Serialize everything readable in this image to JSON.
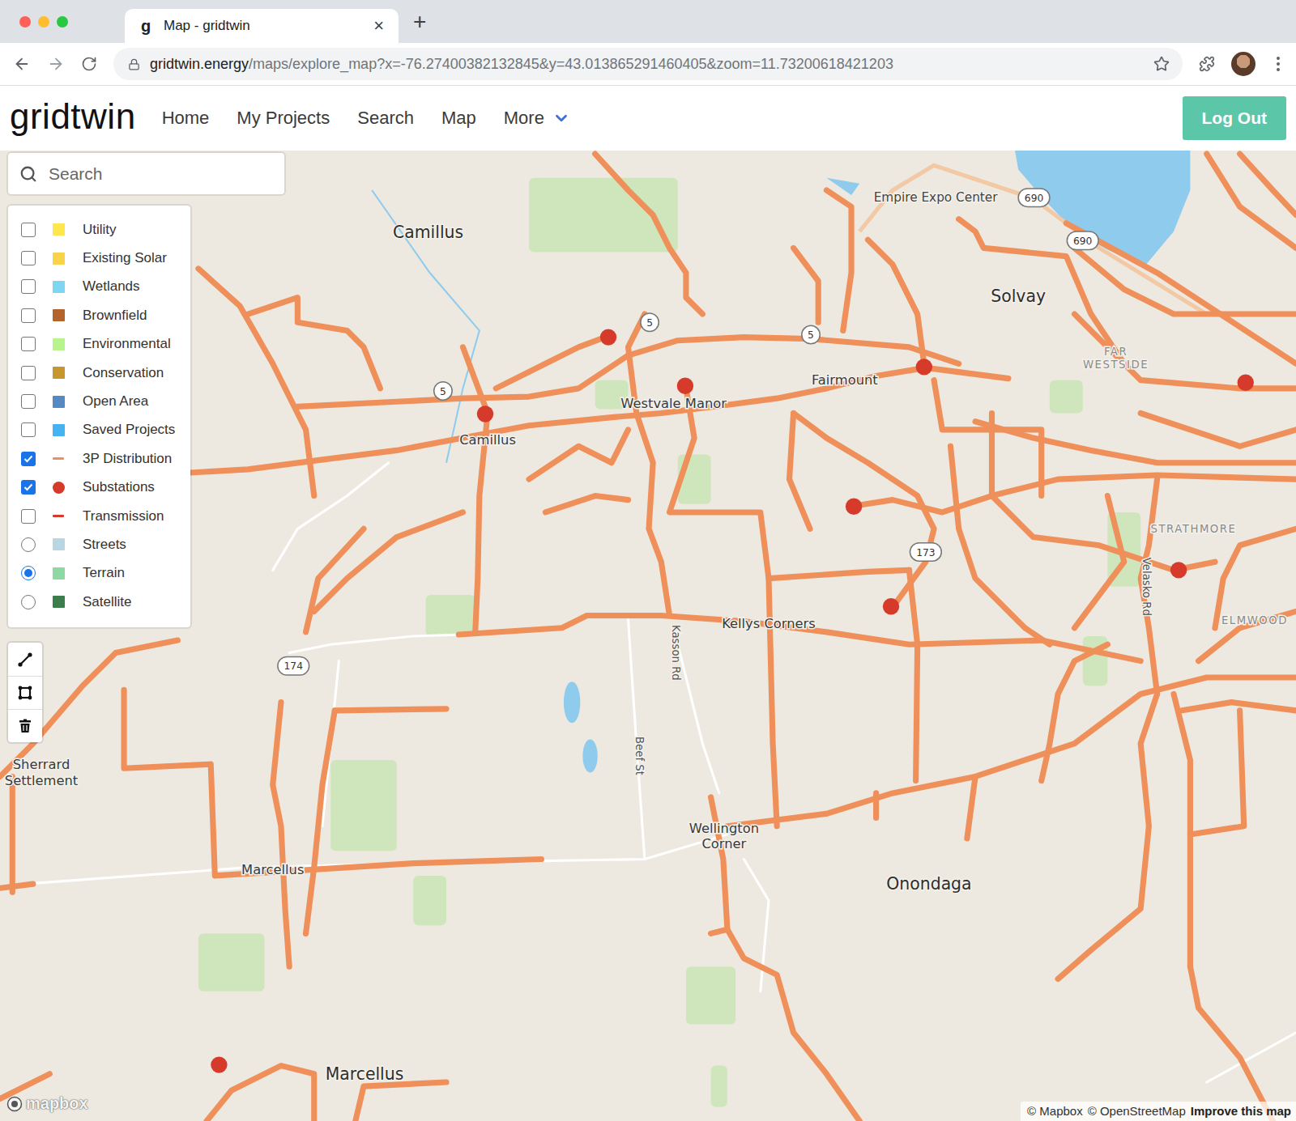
{
  "browser": {
    "tab": {
      "favicon": "g",
      "title": "Map - gridtwin",
      "close": "×"
    },
    "new_tab": "+",
    "address": {
      "host": "gridtwin.energy",
      "path": "/maps/explore_map?x=-76.27400382132845&y=43.013865291460405&zoom=11.73200618421203"
    }
  },
  "app": {
    "logo": "gridtwin",
    "nav": [
      {
        "label": "Home",
        "selected": false
      },
      {
        "label": "My Projects",
        "selected": false
      },
      {
        "label": "Search",
        "selected": false
      },
      {
        "label": "Map",
        "selected": false
      },
      {
        "label": "More",
        "selected": false
      }
    ],
    "logout": "Log Out"
  },
  "map": {
    "search": {
      "placeholder": "Search"
    },
    "layers": [
      {
        "label": "Utility",
        "kind": "checkbox",
        "checked": false,
        "swatch": "square",
        "color": "#fde74c"
      },
      {
        "label": "Existing Solar",
        "kind": "checkbox",
        "checked": false,
        "swatch": "square",
        "color": "#f7d44a"
      },
      {
        "label": "Wetlands",
        "kind": "checkbox",
        "checked": false,
        "swatch": "square",
        "color": "#7dd6f2"
      },
      {
        "label": "Brownfield",
        "kind": "checkbox",
        "checked": false,
        "swatch": "square",
        "color": "#b4632a"
      },
      {
        "label": "Environmental",
        "kind": "checkbox",
        "checked": false,
        "swatch": "square",
        "color": "#b6f48c"
      },
      {
        "label": "Conservation",
        "kind": "checkbox",
        "checked": false,
        "swatch": "square",
        "color": "#c8962e"
      },
      {
        "label": "Open Area",
        "kind": "checkbox",
        "checked": false,
        "swatch": "square",
        "color": "#5489c4"
      },
      {
        "label": "Saved Projects",
        "kind": "checkbox",
        "checked": false,
        "swatch": "square",
        "color": "#45b3f2"
      },
      {
        "label": "3P Distribution",
        "kind": "checkbox",
        "checked": true,
        "swatch": "line",
        "color": "#ef8f5a"
      },
      {
        "label": "Substations",
        "kind": "checkbox",
        "checked": true,
        "swatch": "dot",
        "color": "#d63a2b"
      },
      {
        "label": "Transmission",
        "kind": "checkbox",
        "checked": false,
        "swatch": "line",
        "color": "#d63a2b"
      },
      {
        "label": "Streets",
        "kind": "radio",
        "checked": false,
        "swatch": "square",
        "color": "#b9d7e2"
      },
      {
        "label": "Terrain",
        "kind": "radio",
        "checked": true,
        "swatch": "square",
        "color": "#8dd9a1"
      },
      {
        "label": "Satellite",
        "kind": "radio",
        "checked": false,
        "swatch": "square",
        "color": "#3b7d4b"
      }
    ],
    "places": [
      {
        "lines": [
          "Camillus"
        ],
        "style": "town"
      },
      {
        "lines": [
          "Empire Expo Center"
        ],
        "style": "poi"
      },
      {
        "lines": [
          "Solvay"
        ],
        "style": "town"
      },
      {
        "lines": [
          "FAR",
          "WESTSIDE"
        ],
        "style": "area"
      },
      {
        "lines": [
          "Westvale Manor"
        ],
        "style": "village"
      },
      {
        "lines": [
          "Fairmount"
        ],
        "style": "village"
      },
      {
        "lines": [
          "Camillus"
        ],
        "style": "village"
      },
      {
        "lines": [
          "Kellys Corners"
        ],
        "style": "village"
      },
      {
        "lines": [
          "Kasson Rd"
        ],
        "style": "road"
      },
      {
        "lines": [
          "Beef St"
        ],
        "style": "road"
      },
      {
        "lines": [
          "Wellington",
          "Corner"
        ],
        "style": "village"
      },
      {
        "lines": [
          "Onondaga"
        ],
        "style": "town"
      },
      {
        "lines": [
          "Marcellus"
        ],
        "style": "town"
      },
      {
        "lines": [
          "Marcellus"
        ],
        "style": "village"
      },
      {
        "lines": [
          "Sherrard",
          "Settlement"
        ],
        "style": "village"
      },
      {
        "lines": [
          "STRATHMORE"
        ],
        "style": "area"
      },
      {
        "lines": [
          "ELMWOOD"
        ],
        "style": "area"
      },
      {
        "lines": [
          "Velasko Rd"
        ],
        "style": "road"
      }
    ],
    "routes": [
      {
        "number": "5"
      },
      {
        "number": "5"
      },
      {
        "number": "5"
      },
      {
        "number": "690"
      },
      {
        "number": "690"
      },
      {
        "number": "174"
      },
      {
        "number": "173"
      }
    ],
    "logo": "mapbox",
    "attribution": {
      "credits": [
        "© Mapbox",
        "© OpenStreetMap"
      ],
      "link": "Improve this map"
    }
  }
}
